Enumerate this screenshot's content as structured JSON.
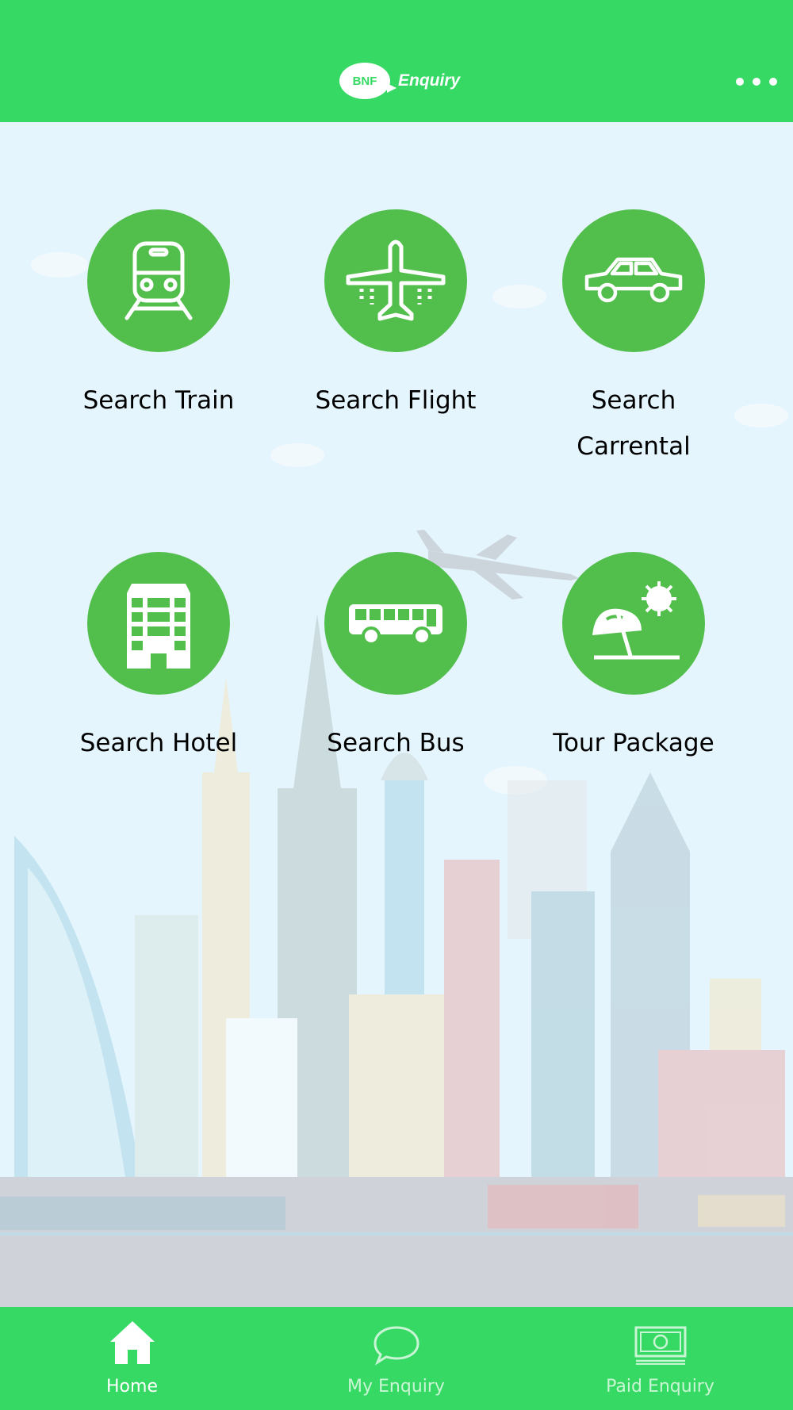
{
  "header": {
    "logo_badge": "BNF",
    "logo_text": "Enquiry",
    "menu_icon": "more-horizontal-icon"
  },
  "tiles": [
    {
      "label": "Search Train",
      "icon": "train-icon"
    },
    {
      "label": "Search Flight",
      "icon": "airplane-icon"
    },
    {
      "label": "Search Carrental",
      "icon": "car-icon"
    },
    {
      "label": "Search Hotel",
      "icon": "hotel-icon"
    },
    {
      "label": "Search Bus",
      "icon": "bus-icon"
    },
    {
      "label": "Tour Package",
      "icon": "beach-umbrella-icon"
    }
  ],
  "navbar": {
    "items": [
      {
        "label": "Home",
        "icon": "home-icon",
        "active": true
      },
      {
        "label": "My Enquiry",
        "icon": "chat-bubble-icon",
        "active": false
      },
      {
        "label": "Paid Enquiry",
        "icon": "money-icon",
        "active": false
      }
    ]
  },
  "colors": {
    "primary_green": "#36d964",
    "circle_green": "#52be4c",
    "background": "#e5f5fd",
    "nav_active": "#ffffff",
    "nav_inactive": "#c8f5d4"
  }
}
